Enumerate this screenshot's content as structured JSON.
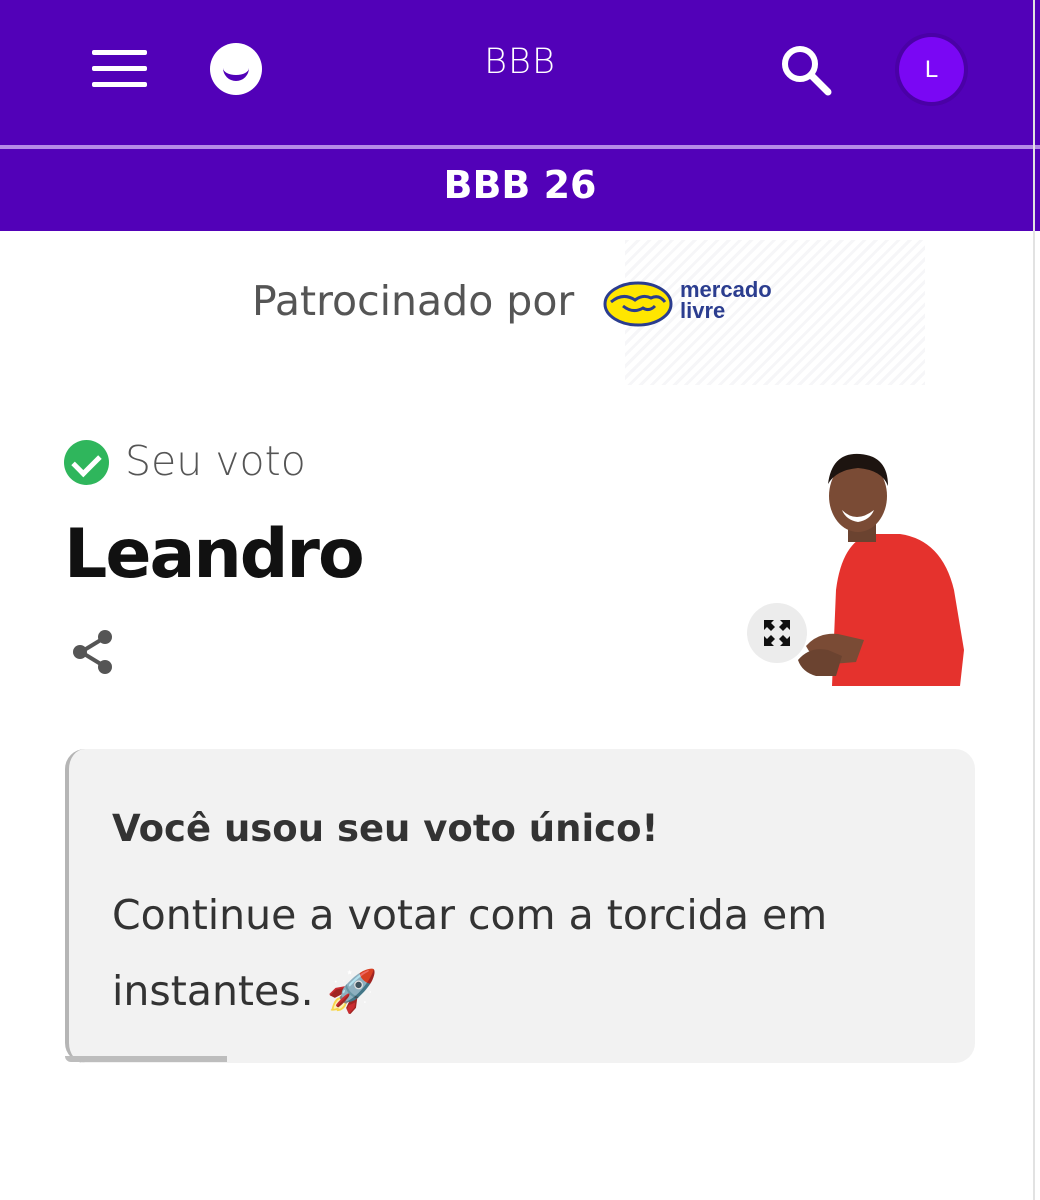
{
  "header": {
    "title": "BBB",
    "avatar_initial": "L",
    "brand_color": "#5201b8"
  },
  "subheader": {
    "title": "BBB 26"
  },
  "sponsor": {
    "label": "Patrocinado por",
    "brand_name_line1": "mercado",
    "brand_name_line2": "livre"
  },
  "vote": {
    "status_label": "Seu voto",
    "candidate_name": "Leandro",
    "status_color": "#2fb65c"
  },
  "notice": {
    "title": "Você usou seu voto único!",
    "body": "Continue a votar com a torcida em instantes. 🚀"
  },
  "icons": [
    "menu-icon",
    "logo-icon",
    "search-icon",
    "check-icon",
    "share-icon",
    "expand-icon"
  ]
}
